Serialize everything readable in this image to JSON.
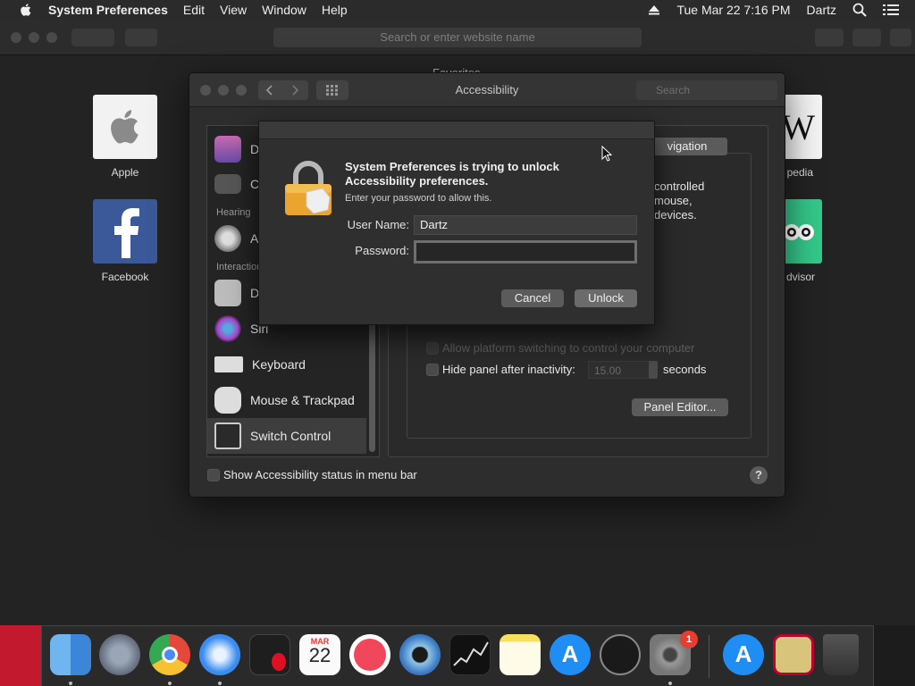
{
  "menubar": {
    "app_name": "System Preferences",
    "items": [
      "Edit",
      "View",
      "Window",
      "Help"
    ],
    "datetime": "Tue Mar 22  7:16 PM",
    "user": "Dartz"
  },
  "safari": {
    "url_placeholder": "Search or enter website name",
    "favorites_title": "Favorites",
    "favorites": [
      {
        "name": "Apple"
      },
      {
        "name": "Facebook"
      },
      {
        "name": "pedia"
      },
      {
        "name": ".dvisor"
      }
    ]
  },
  "prefs": {
    "title": "Accessibility",
    "search_placeholder": "Search",
    "sidebar": {
      "sections": [
        "Hearing",
        "Interaction"
      ],
      "items": [
        {
          "label": "D",
          "icon": "display-icon"
        },
        {
          "label": "C",
          "icon": "captions-icon"
        },
        {
          "label": "A",
          "icon": "audio-icon"
        },
        {
          "label": "D",
          "icon": "dictation-icon"
        },
        {
          "label": "Siri",
          "icon": "siri-icon"
        },
        {
          "label": "Keyboard",
          "icon": "keyboard-icon"
        },
        {
          "label": "Mouse & Trackpad",
          "icon": "mouse-icon"
        },
        {
          "label": "Switch Control",
          "icon": "switch-control-icon"
        }
      ]
    },
    "main": {
      "tab_visible": "vigation",
      "description": [
        "controlled",
        "mouse,",
        "devices."
      ],
      "allow_switching": "Allow platform switching to control your computer",
      "hide_panel": "Hide panel after inactivity:",
      "hide_panel_value": "15.00",
      "seconds": "seconds",
      "panel_editor": "Panel Editor..."
    },
    "status_checkbox": "Show Accessibility status in menu bar",
    "help": "?"
  },
  "sheet": {
    "title": "System Preferences is trying to unlock Accessibility preferences.",
    "subtitle": "Enter your password to allow this.",
    "username_label": "User Name:",
    "username_value": "Dartz",
    "password_label": "Password:",
    "password_value": "",
    "cancel": "Cancel",
    "unlock": "Unlock"
  },
  "dock": {
    "calendar_month": "MAR",
    "calendar_day": "22",
    "badge": "1",
    "apps": [
      "finder-icon",
      "launchpad-icon",
      "chrome-icon",
      "safari-icon",
      "voice-memos-icon",
      "calendar-icon",
      "news-icon",
      "quicktime-icon",
      "stocks-icon",
      "notes-icon",
      "app-store-icon",
      "activity-monitor-icon",
      "system-preferences-icon",
      "app-store-2-icon",
      "photo-booth-icon",
      "trash-icon"
    ]
  }
}
